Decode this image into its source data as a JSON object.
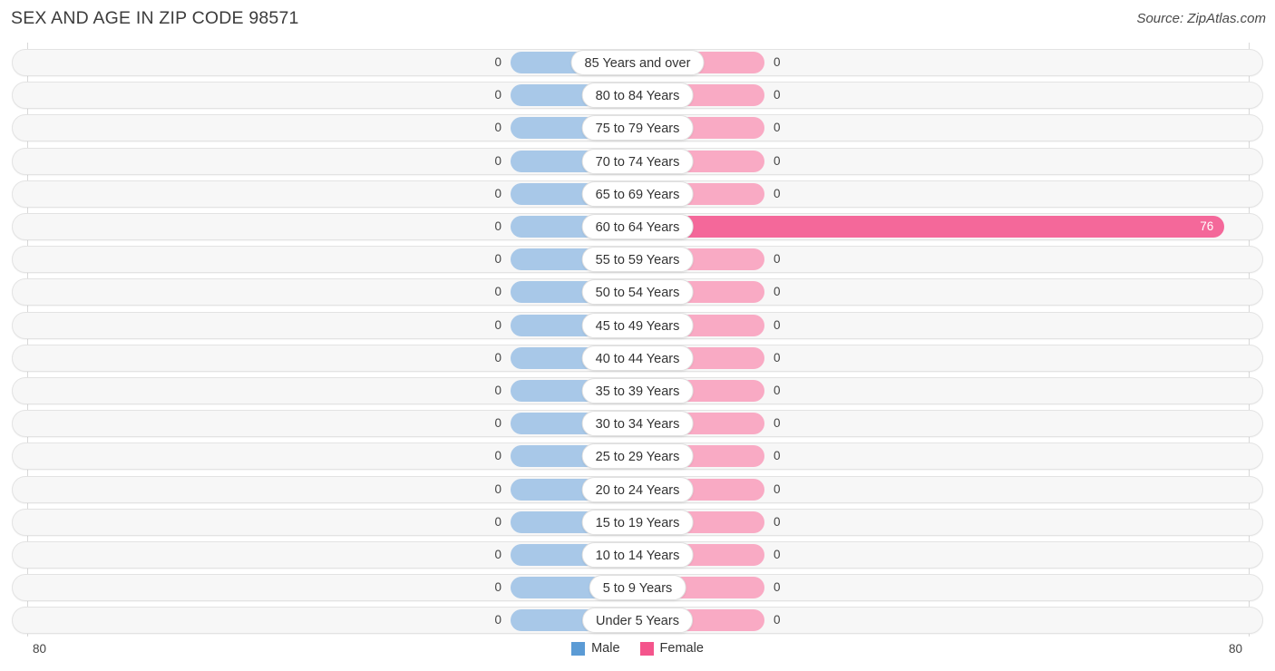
{
  "header": {
    "title": "SEX AND AGE IN ZIP CODE 98571",
    "source": "Source: ZipAtlas.com"
  },
  "legend": {
    "male_label": "Male",
    "female_label": "Female",
    "male_color": "#5b9bd5",
    "female_color": "#f4558c"
  },
  "axis": {
    "left_max_label": "80",
    "right_max_label": "80"
  },
  "colors": {
    "male_bar": "#a8c8e8",
    "female_bar": "#f9aac4",
    "female_bar_highlight": "#f4689a",
    "row_background": "#f7f7f7",
    "row_border": "#e3e3e3",
    "gridline": "#d8d8d8"
  },
  "chart_data": {
    "type": "bar",
    "title": "SEX AND AGE IN ZIP CODE 98571",
    "subtitle": "Source: ZipAtlas.com",
    "orientation": "horizontal",
    "style": "population-pyramid",
    "xlabel": "",
    "ylabel": "",
    "xlim": [
      80,
      80
    ],
    "axis_left_max": 80,
    "axis_right_max": 80,
    "grid": true,
    "legend_position": "bottom-center",
    "categories": [
      "85 Years and over",
      "80 to 84 Years",
      "75 to 79 Years",
      "70 to 74 Years",
      "65 to 69 Years",
      "60 to 64 Years",
      "55 to 59 Years",
      "50 to 54 Years",
      "45 to 49 Years",
      "40 to 44 Years",
      "35 to 39 Years",
      "30 to 34 Years",
      "25 to 29 Years",
      "20 to 24 Years",
      "15 to 19 Years",
      "10 to 14 Years",
      "5 to 9 Years",
      "Under 5 Years"
    ],
    "series": [
      {
        "name": "Male",
        "color": "#5b9bd5",
        "values": [
          0,
          0,
          0,
          0,
          0,
          0,
          0,
          0,
          0,
          0,
          0,
          0,
          0,
          0,
          0,
          0,
          0,
          0
        ]
      },
      {
        "name": "Female",
        "color": "#f4558c",
        "values": [
          0,
          0,
          0,
          0,
          0,
          76,
          0,
          0,
          0,
          0,
          0,
          0,
          0,
          0,
          0,
          0,
          0,
          0
        ]
      }
    ]
  },
  "rows": [
    {
      "label": "85 Years and over",
      "male": "0",
      "female": "0",
      "male_value": 0,
      "female_value": 0
    },
    {
      "label": "80 to 84 Years",
      "male": "0",
      "female": "0",
      "male_value": 0,
      "female_value": 0
    },
    {
      "label": "75 to 79 Years",
      "male": "0",
      "female": "0",
      "male_value": 0,
      "female_value": 0
    },
    {
      "label": "70 to 74 Years",
      "male": "0",
      "female": "0",
      "male_value": 0,
      "female_value": 0
    },
    {
      "label": "65 to 69 Years",
      "male": "0",
      "female": "0",
      "male_value": 0,
      "female_value": 0
    },
    {
      "label": "60 to 64 Years",
      "male": "0",
      "female": "76",
      "male_value": 0,
      "female_value": 76
    },
    {
      "label": "55 to 59 Years",
      "male": "0",
      "female": "0",
      "male_value": 0,
      "female_value": 0
    },
    {
      "label": "50 to 54 Years",
      "male": "0",
      "female": "0",
      "male_value": 0,
      "female_value": 0
    },
    {
      "label": "45 to 49 Years",
      "male": "0",
      "female": "0",
      "male_value": 0,
      "female_value": 0
    },
    {
      "label": "40 to 44 Years",
      "male": "0",
      "female": "0",
      "male_value": 0,
      "female_value": 0
    },
    {
      "label": "35 to 39 Years",
      "male": "0",
      "female": "0",
      "male_value": 0,
      "female_value": 0
    },
    {
      "label": "30 to 34 Years",
      "male": "0",
      "female": "0",
      "male_value": 0,
      "female_value": 0
    },
    {
      "label": "25 to 29 Years",
      "male": "0",
      "female": "0",
      "male_value": 0,
      "female_value": 0
    },
    {
      "label": "20 to 24 Years",
      "male": "0",
      "female": "0",
      "male_value": 0,
      "female_value": 0
    },
    {
      "label": "15 to 19 Years",
      "male": "0",
      "female": "0",
      "male_value": 0,
      "female_value": 0
    },
    {
      "label": "10 to 14 Years",
      "male": "0",
      "female": "0",
      "male_value": 0,
      "female_value": 0
    },
    {
      "label": "5 to 9 Years",
      "male": "0",
      "female": "0",
      "male_value": 0,
      "female_value": 0
    },
    {
      "label": "Under 5 Years",
      "male": "0",
      "female": "0",
      "male_value": 0,
      "female_value": 0
    }
  ]
}
